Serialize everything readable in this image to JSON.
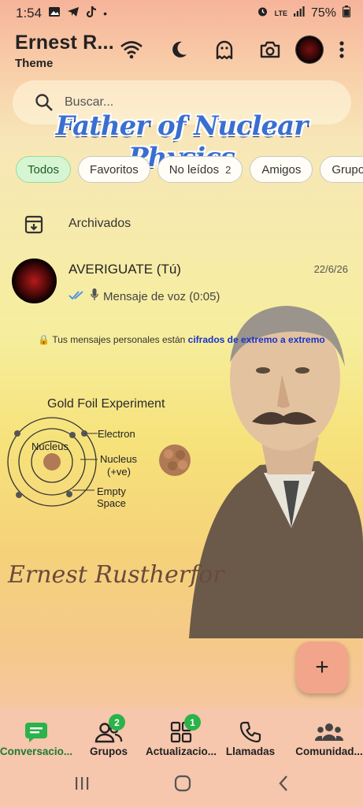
{
  "status_bar": {
    "time": "1:54",
    "battery": "75%",
    "signal_label": "LTE"
  },
  "header": {
    "title": "Ernest R...",
    "subtitle": "Theme"
  },
  "search": {
    "placeholder": "Buscar..."
  },
  "wallpaper_title": "Father of Nuclear Physics",
  "filters": [
    {
      "label": "Todos"
    },
    {
      "label": "Favoritos"
    },
    {
      "label": "No leídos",
      "count": "2"
    },
    {
      "label": "Amigos"
    },
    {
      "label": "Grupos"
    }
  ],
  "archived_label": "Archivados",
  "chat": {
    "name": "AVERIGUATE (Tú)",
    "date": "22/6/26",
    "last_message": "Mensaje de voz (0:05)"
  },
  "encryption": {
    "prefix": "Tus mensajes personales están ",
    "link": "cifrados de extremo a extremo"
  },
  "illustration": {
    "title": "Gold Foil Experiment",
    "labels": {
      "nucleus_small": "Nucleus",
      "electron": "Electron",
      "nucleus_big": "Nucleus",
      "nucleus_charge": "(+ve)",
      "empty_space": "Empty",
      "empty_space2": "Space"
    },
    "signature": "Ernest Rustherfor"
  },
  "fab_label": "+",
  "bottom_nav": [
    {
      "label": "Conversacio...",
      "badge": ""
    },
    {
      "label": "Grupos",
      "badge": "2"
    },
    {
      "label": "Actualizacio...",
      "badge": "1"
    },
    {
      "label": "Llamadas",
      "badge": ""
    },
    {
      "label": "Comunidad...",
      "badge": ""
    }
  ],
  "colors": {
    "accent_green": "#2bb24b",
    "active_chip_bg": "#d6f5d3",
    "link_blue": "#1a33c8",
    "fab": "#f2a58a"
  }
}
